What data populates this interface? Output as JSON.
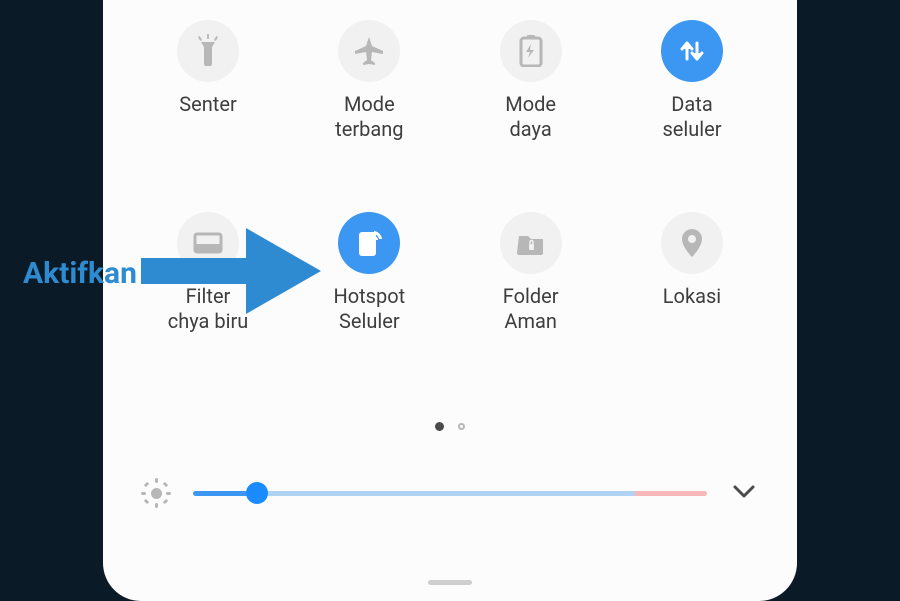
{
  "annotation": {
    "text": "Aktifkan"
  },
  "tiles": {
    "row1": [
      {
        "label": "Senter",
        "active": false
      },
      {
        "label": "Mode\nterbang",
        "active": false
      },
      {
        "label": "Mode\ndaya",
        "active": false
      },
      {
        "label": "Data\nseluler",
        "active": true
      }
    ],
    "row2": [
      {
        "label": "Filter\nchya biru",
        "active": false
      },
      {
        "label": "Hotspot\nSeluler",
        "active": true
      },
      {
        "label": "Folder\nAman",
        "active": false
      },
      {
        "label": "Lokasi",
        "active": false
      }
    ]
  },
  "pager": {
    "current": 0,
    "total": 2
  },
  "brightness": {
    "value_pct": 12.5
  }
}
